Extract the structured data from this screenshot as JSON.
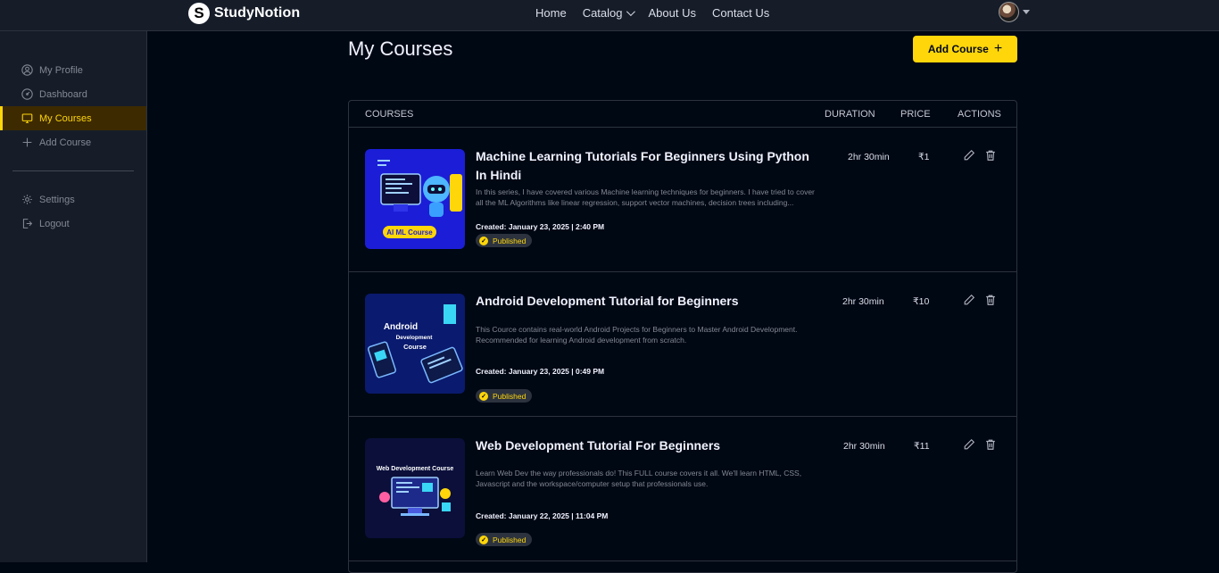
{
  "header": {
    "logo_mark": "S",
    "logo_text": "StudyNotion",
    "nav": [
      {
        "label": "Home"
      },
      {
        "label": "Catalog",
        "dropdown": true
      },
      {
        "label": "About Us"
      },
      {
        "label": "Contact Us"
      }
    ]
  },
  "sidebar": {
    "items": [
      {
        "label": "My Profile",
        "icon": "user-circle-icon",
        "active": false
      },
      {
        "label": "Dashboard",
        "icon": "gauge-icon",
        "active": false
      },
      {
        "label": "My Courses",
        "icon": "monitor-icon",
        "active": true
      },
      {
        "label": "Add Course",
        "icon": "plus-icon",
        "active": false
      },
      {
        "label": "Settings",
        "icon": "gear-icon",
        "active": false
      },
      {
        "label": "Logout",
        "icon": "logout-icon",
        "active": false
      }
    ]
  },
  "main": {
    "title": "My Courses",
    "add_button": "Add Course",
    "add_button_icon": "+"
  },
  "table": {
    "headers": {
      "courses": "COURSES",
      "duration": "DURATION",
      "price": "PRICE",
      "actions": "ACTIONS"
    },
    "rows": [
      {
        "thumb_text": "AI ML Course",
        "title": "Machine Learning Tutorials For Beginners Using Python In Hindi",
        "description": "In this series, I have covered various Machine learning techniques for beginners. I have tried to cover all the ML Algorithms like linear regression, support vector machines, decision trees including...",
        "created": "Created: January 23, 2025 | 2:40 PM",
        "status": "Published",
        "duration": "2hr 30min",
        "price": "₹1"
      },
      {
        "thumb_text": "Android",
        "thumb_subtext": "Development",
        "thumb_subtext2": "Course",
        "title": "Android Development Tutorial for Beginners",
        "description": "This Cource contains real-world Android Projects for Beginners to Master Android Development. Recommended for learning Android development from scratch.",
        "created": "Created: January 23, 2025 | 0:49 PM",
        "status": "Published",
        "duration": "2hr 30min",
        "price": "₹10"
      },
      {
        "thumb_text": "Web Development Course",
        "title": "Web Development Tutorial For Beginners",
        "description": "Learn Web Dev the way professionals do! This FULL course covers it all. We'll learn HTML, CSS, Javascript and the workspace/computer setup that professionals use.",
        "created": "Created: January 22, 2025 | 11:04 PM",
        "status": "Published",
        "duration": "2hr 30min",
        "price": "₹11"
      }
    ]
  },
  "colors": {
    "accent": "#FFD60A",
    "background": "#000814",
    "panel": "#161D29",
    "active_bg": "#3D2A01"
  }
}
